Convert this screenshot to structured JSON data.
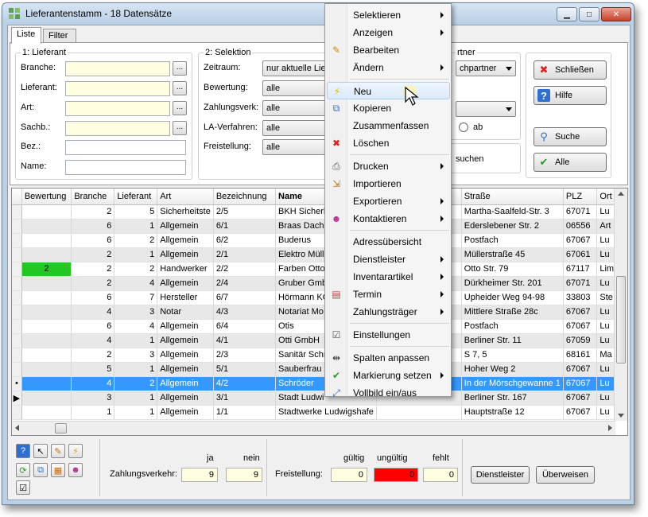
{
  "window": {
    "title": "Lieferantenstamm - 18 Datensätze"
  },
  "tabs": [
    "Liste",
    "Filter"
  ],
  "lieferant": {
    "title": "1: Lieferant",
    "fields": [
      {
        "label": "Branche:",
        "value": ""
      },
      {
        "label": "Lieferant:",
        "value": ""
      },
      {
        "label": "Art:",
        "value": ""
      },
      {
        "label": "Sachb.:",
        "value": ""
      },
      {
        "label": "Bez.:",
        "value": ""
      },
      {
        "label": "Name:",
        "value": ""
      }
    ]
  },
  "selektion": {
    "title": "2: Selektion",
    "fields": [
      {
        "label": "Zeitraum:",
        "value": "nur aktuelle Liefe"
      },
      {
        "label": "Bewertung:",
        "value": "alle"
      },
      {
        "label": "Zahlungsverk:",
        "value": "alle"
      },
      {
        "label": "LA-Verfahren:",
        "value": "alle"
      },
      {
        "label": "Freistellung:",
        "value": "alle"
      }
    ]
  },
  "partner": {
    "title_fragment": "rtner",
    "combo_value": "chpartner",
    "radio_label": "ab",
    "search_fragment": "suchen"
  },
  "side_buttons": {
    "schliessen": "Schließen",
    "hilfe": "Hilfe",
    "suche": "Suche",
    "alle": "Alle"
  },
  "grid": {
    "columns": [
      "",
      "Bewertung",
      "Branche",
      "Lieferant",
      "Art",
      "Bezeichnung",
      "Name",
      "",
      "Straße",
      "PLZ",
      "Ort"
    ],
    "rows": [
      {
        "ind": "",
        "bew": "",
        "branche": "2",
        "lief": "5",
        "art": "Sicherheitste",
        "bez": "2/5",
        "name": "BKH Sicherh",
        "strasse": "Martha-Saalfeld-Str. 3",
        "plz": "67071",
        "ort": "Lu"
      },
      {
        "ind": "",
        "bew": "",
        "branche": "6",
        "lief": "1",
        "art": "Allgemein",
        "bez": "6/1",
        "name": "Braas Dacha",
        "strasse": "Edersleben​er Str. 2",
        "plz": "06556",
        "ort": "Art"
      },
      {
        "ind": "",
        "bew": "",
        "branche": "6",
        "lief": "2",
        "art": "Allgemein",
        "bez": "6/2",
        "name": "Buderus",
        "strasse": "Postfach",
        "plz": "67067",
        "ort": "Lu"
      },
      {
        "ind": "",
        "bew": "",
        "branche": "2",
        "lief": "1",
        "art": "Allgemein",
        "bez": "2/1",
        "name": "Elektro Mülle",
        "strasse": "Müllerstraße 45",
        "plz": "67061",
        "ort": "Lu"
      },
      {
        "ind": "",
        "bew": "2",
        "branche": "2",
        "lief": "2",
        "art": "Handwerker",
        "bez": "2/2",
        "name": "Farben Otto",
        "strasse": "Otto Str. 79",
        "plz": "67117",
        "ort": "Lim"
      },
      {
        "ind": "",
        "bew": "",
        "branche": "2",
        "lief": "4",
        "art": "Allgemein",
        "bez": "2/4",
        "name": "Gruber Gmb",
        "strasse": "Dürkheimer Str. 201",
        "plz": "67071",
        "ort": "Lu"
      },
      {
        "ind": "",
        "bew": "",
        "branche": "6",
        "lief": "7",
        "art": "Hersteller",
        "bez": "6/7",
        "name": "Hörmann KG",
        "strasse": "Upheider Weg 94-98",
        "plz": "33803",
        "ort": "Ste"
      },
      {
        "ind": "",
        "bew": "",
        "branche": "4",
        "lief": "3",
        "art": "Notar",
        "bez": "4/3",
        "name": "Notariat Mo",
        "strasse": "Mittlere Straße 28c",
        "plz": "67067",
        "ort": "Lu"
      },
      {
        "ind": "",
        "bew": "",
        "branche": "6",
        "lief": "4",
        "art": "Allgemein",
        "bez": "6/4",
        "name": "Otis",
        "strasse": "Postfach",
        "plz": "67067",
        "ort": "Lu"
      },
      {
        "ind": "",
        "bew": "",
        "branche": "4",
        "lief": "1",
        "art": "Allgemein",
        "bez": "4/1",
        "name": "Otti GmbH",
        "strasse": "Berliner Str. 11",
        "plz": "67059",
        "ort": "Lu"
      },
      {
        "ind": "",
        "bew": "",
        "branche": "2",
        "lief": "3",
        "art": "Allgemein",
        "bez": "2/3",
        "name": "Sanitär Schr",
        "strasse": "S 7, 5",
        "plz": "68161",
        "ort": "Ma"
      },
      {
        "ind": "",
        "bew": "",
        "branche": "5",
        "lief": "1",
        "art": "Allgemein",
        "bez": "5/1",
        "name": "Sauberfrau",
        "strasse": "Hoher Weg 2",
        "plz": "67067",
        "ort": "Lu"
      },
      {
        "ind": "•",
        "bew": "",
        "branche": "4",
        "lief": "2",
        "art": "Allgemein",
        "bez": "4/2",
        "name": "Schröder",
        "strasse": "In der Mörschgewanne 1",
        "plz": "67067",
        "ort": "Lu"
      },
      {
        "ind": "▶",
        "bew": "",
        "branche": "3",
        "lief": "1",
        "art": "Allgemein",
        "bez": "3/1",
        "name": "Stadt Ludwi",
        "strasse": "Berliner Str. 167",
        "plz": "67067",
        "ort": "Lu"
      },
      {
        "ind": "",
        "bew": "",
        "branche": "1",
        "lief": "1",
        "art": "Allgemein",
        "bez": "1/1",
        "name": "Stadtwerke Ludwigshafe",
        "strasse": "Hauptstraße 12",
        "plz": "67067",
        "ort": "Lu"
      }
    ]
  },
  "bottom": {
    "zahlung": {
      "label": "Zahlungsverkehr:",
      "ja_header": "ja",
      "nein_header": "nein",
      "ja": "9",
      "nein": "9"
    },
    "freistellung": {
      "label": "Freistellung:",
      "gueltig_header": "gültig",
      "ungueltig_header": "ungültig",
      "fehlt_header": "fehlt",
      "gueltig": "0",
      "ungueltig": "0",
      "fehlt": "0",
      "ungueltig_color": "#ff0000"
    },
    "buttons": {
      "dienstleister": "Dienstleister",
      "ueberweisen": "Überweisen"
    }
  },
  "context_menu": {
    "items": [
      {
        "label": "Selektieren",
        "icon": "",
        "submenu": true
      },
      {
        "label": "Anzeigen",
        "icon": "",
        "submenu": true
      },
      {
        "label": "Bearbeiten",
        "icon": "pencil-icon",
        "submenu": false
      },
      {
        "label": "Ändern",
        "icon": "",
        "submenu": true
      },
      {
        "label": "Neu",
        "icon": "lightning-icon",
        "submenu": false
      },
      {
        "label": "Kopieren",
        "icon": "copy-icon",
        "submenu": false
      },
      {
        "label": "Zusammenfassen",
        "icon": "",
        "submenu": false
      },
      {
        "label": "Löschen",
        "icon": "delete-x-icon",
        "submenu": false
      },
      {
        "label": "Drucken",
        "icon": "printer-icon",
        "submenu": true
      },
      {
        "label": "Importieren",
        "icon": "import-icon",
        "submenu": false
      },
      {
        "label": "Exportieren",
        "icon": "",
        "submenu": true
      },
      {
        "label": "Kontaktieren",
        "icon": "contacts-icon",
        "submenu": true
      },
      {
        "label": "Adressübersicht",
        "icon": "",
        "submenu": false
      },
      {
        "label": "Dienstleister",
        "icon": "",
        "submenu": true
      },
      {
        "label": "Inventarartikel",
        "icon": "",
        "submenu": true
      },
      {
        "label": "Termin",
        "icon": "calendar-icon",
        "submenu": true
      },
      {
        "label": "Zahlungsträger",
        "icon": "",
        "submenu": true
      },
      {
        "label": "Einstellungen",
        "icon": "checkbox-icon",
        "submenu": false
      },
      {
        "label": "Spalten anpassen",
        "icon": "columns-icon",
        "submenu": false
      },
      {
        "label": "Markierung setzen",
        "icon": "checkmark-icon",
        "submenu": true
      },
      {
        "label": "Vollbild ein/aus",
        "icon": "fullscreen-icon",
        "submenu": false
      }
    ]
  }
}
